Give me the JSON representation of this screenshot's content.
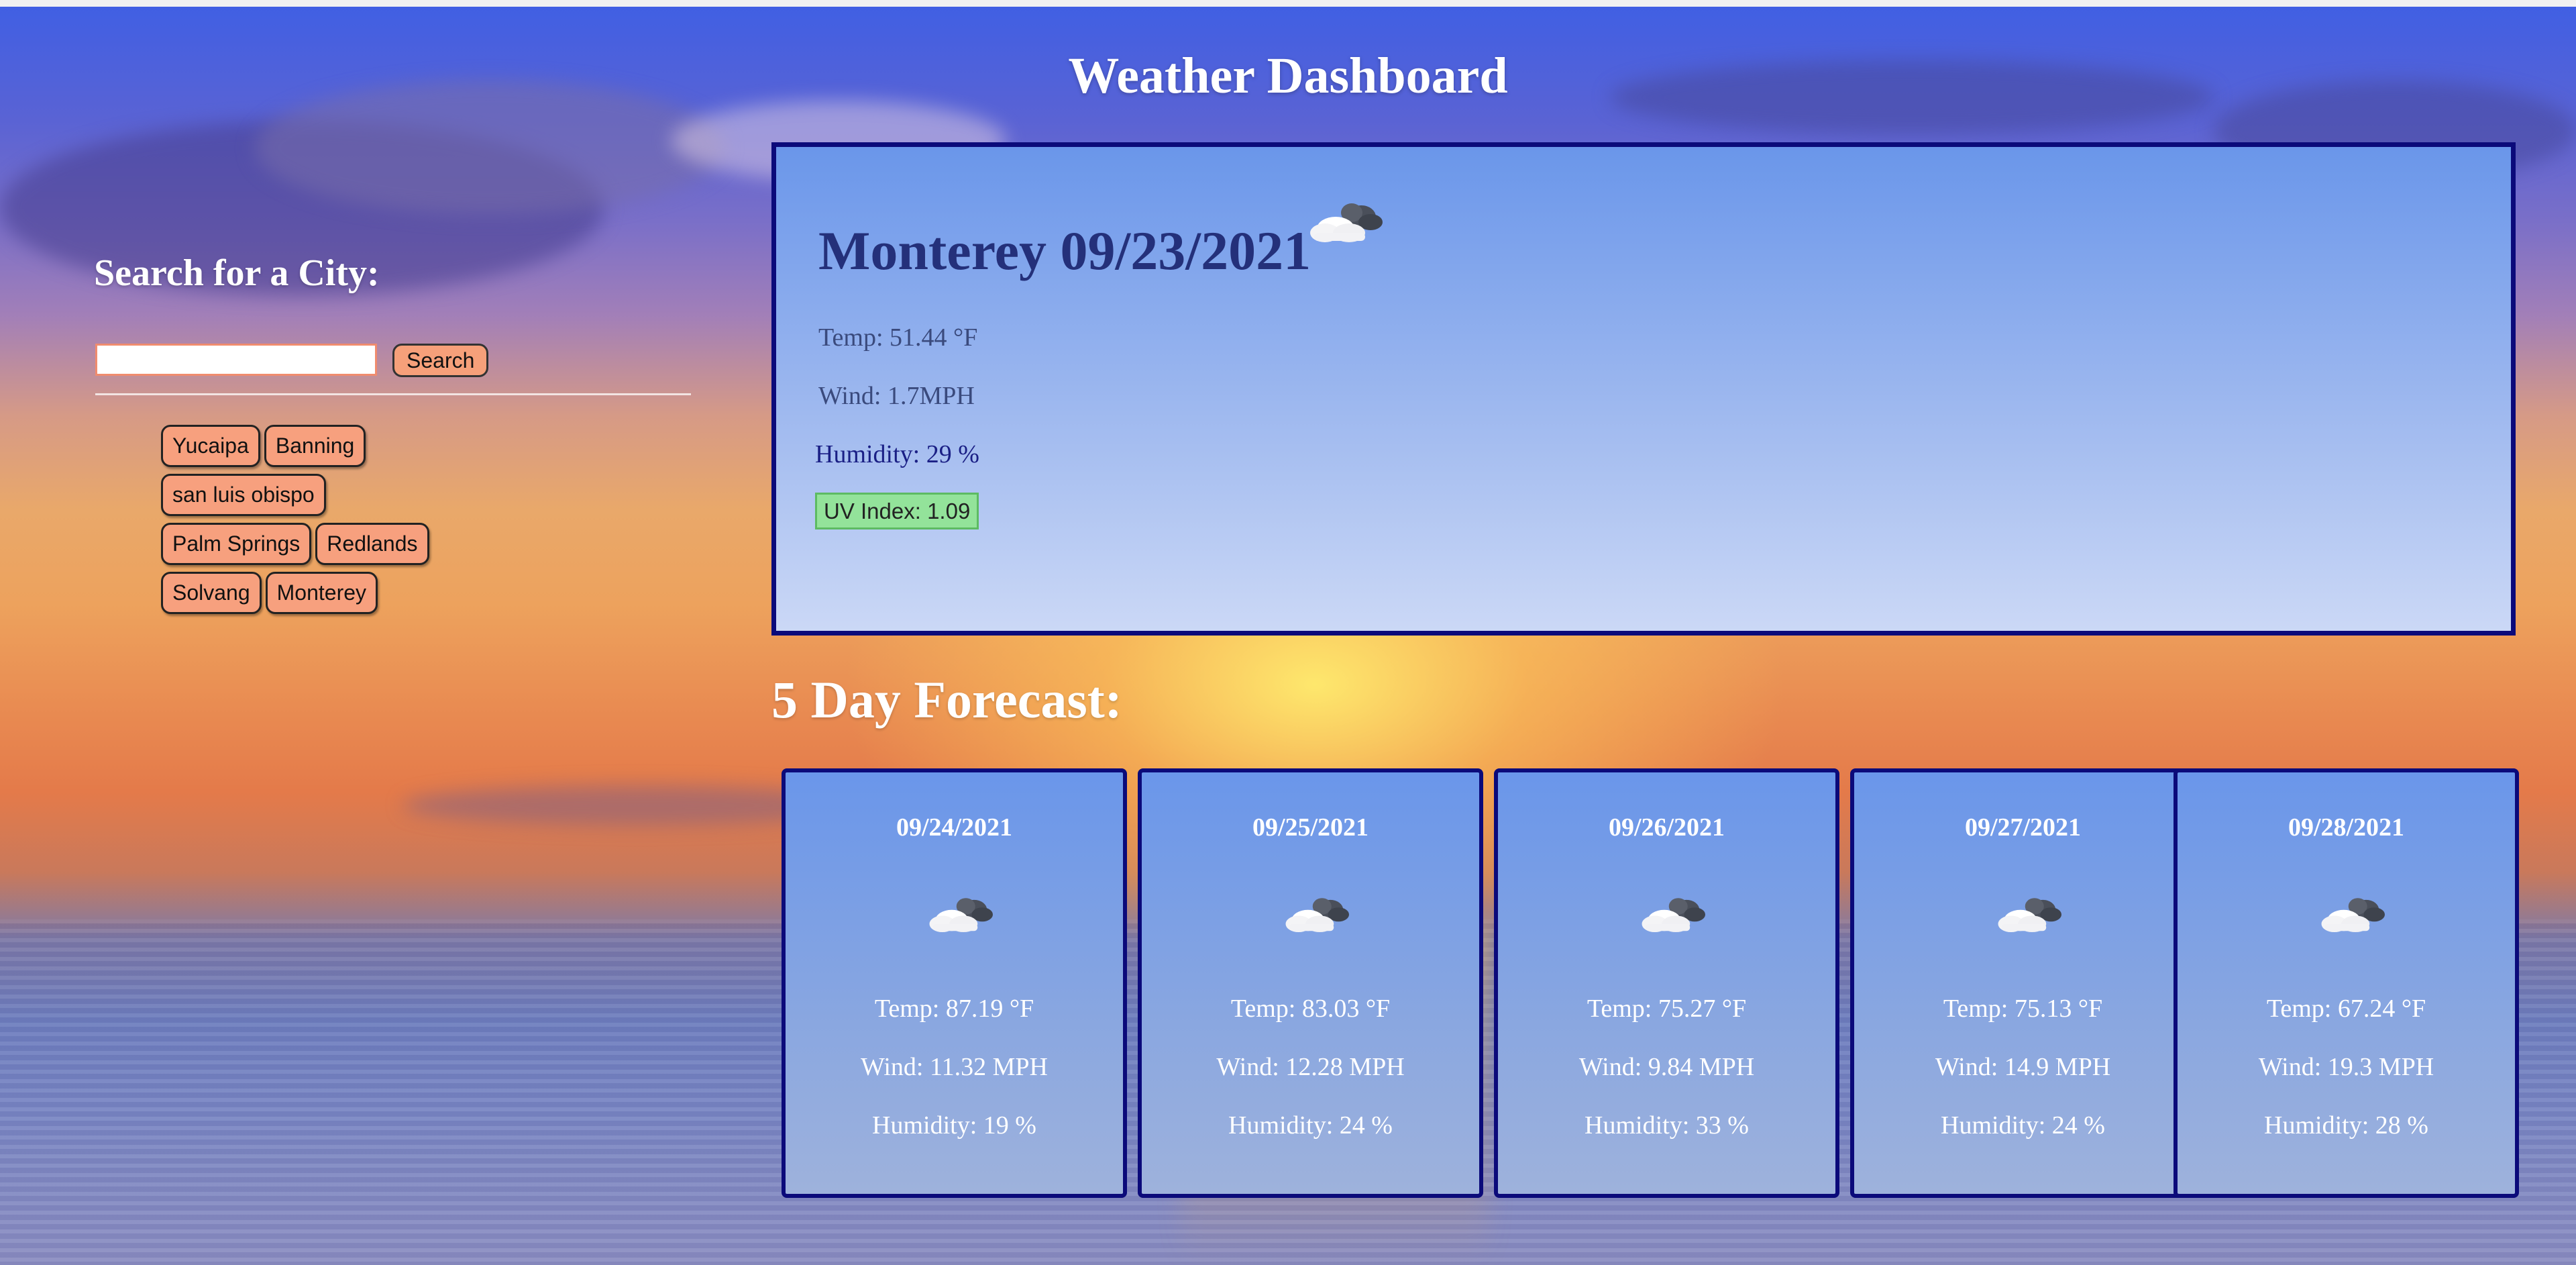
{
  "header": {
    "title": "Weather Dashboard"
  },
  "search": {
    "heading": "Search for a City:",
    "input_value": "",
    "button_label": "Search",
    "history": [
      [
        "Yucaipa",
        "Banning"
      ],
      [
        "san luis obispo"
      ],
      [
        "Palm Springs",
        "Redlands"
      ],
      [
        "Solvang",
        "Monterey"
      ]
    ]
  },
  "current": {
    "title": "Monterey 09/23/2021",
    "icon": "partly-cloudy-icon",
    "temp": "Temp: 51.44 °F",
    "wind": "Wind: 1.7MPH",
    "humidity": "Humidity: 29 %",
    "uv": "UV Index: 1.09",
    "uv_color": "#93e39a"
  },
  "forecast": {
    "heading": "5 Day Forecast:",
    "days": [
      {
        "date": "09/24/2021",
        "icon": "partly-cloudy-icon",
        "temp": "Temp: 87.19 °F",
        "wind": "Wind: 11.32 MPH",
        "humidity": "Humidity: 19 %"
      },
      {
        "date": "09/25/2021",
        "icon": "partly-cloudy-icon",
        "temp": "Temp: 83.03 °F",
        "wind": "Wind: 12.28 MPH",
        "humidity": "Humidity: 24 %"
      },
      {
        "date": "09/26/2021",
        "icon": "partly-cloudy-icon",
        "temp": "Temp: 75.27 °F",
        "wind": "Wind: 9.84 MPH",
        "humidity": "Humidity: 33 %"
      },
      {
        "date": "09/27/2021",
        "icon": "partly-cloudy-icon",
        "temp": "Temp: 75.13 °F",
        "wind": "Wind: 14.9 MPH",
        "humidity": "Humidity: 24 %"
      },
      {
        "date": "09/28/2021",
        "icon": "partly-cloudy-icon",
        "temp": "Temp: 67.24 °F",
        "wind": "Wind: 19.3 MPH",
        "humidity": "Humidity: 28 %"
      }
    ]
  },
  "colors": {
    "accent_button": "#f7a07e",
    "panel_border": "#0b0a7a",
    "panel_blue": "#6a96ea"
  }
}
